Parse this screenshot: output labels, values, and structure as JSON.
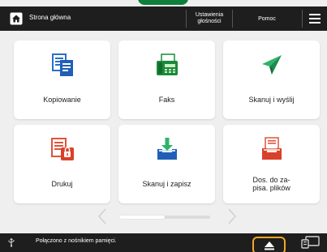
{
  "colors": {
    "header_bg": "#1e1e1e",
    "canvas_bg": "#efefef",
    "tile_bg": "#ffffff",
    "accent_green": "#0c7f3a",
    "highlight_orange": "#f5a623"
  },
  "header": {
    "home_label": "Strona główna",
    "settings_label": "Ustawienia\ngłośności",
    "help_label": "Pomoc",
    "menu_icon": "hamburger-icon"
  },
  "tiles": [
    {
      "label": "Kopiowanie",
      "icon": "copy-icon"
    },
    {
      "label": "Faks",
      "icon": "fax-icon"
    },
    {
      "label": "Skanuj i wyślij",
      "icon": "scan-send-icon"
    },
    {
      "label": "Drukuj",
      "icon": "print-icon"
    },
    {
      "label": "Skanuj i zapisz",
      "icon": "scan-save-icon"
    },
    {
      "label": "Dos. do za-\npisa. plików",
      "icon": "access-stored-files-icon"
    }
  ],
  "pager": {
    "page": 1,
    "pages": 2
  },
  "status": {
    "text": "Połączono z nośnikiem pamięci.",
    "eject_icon": "eject-icon",
    "monitor_icon": "status-monitor-icon"
  }
}
